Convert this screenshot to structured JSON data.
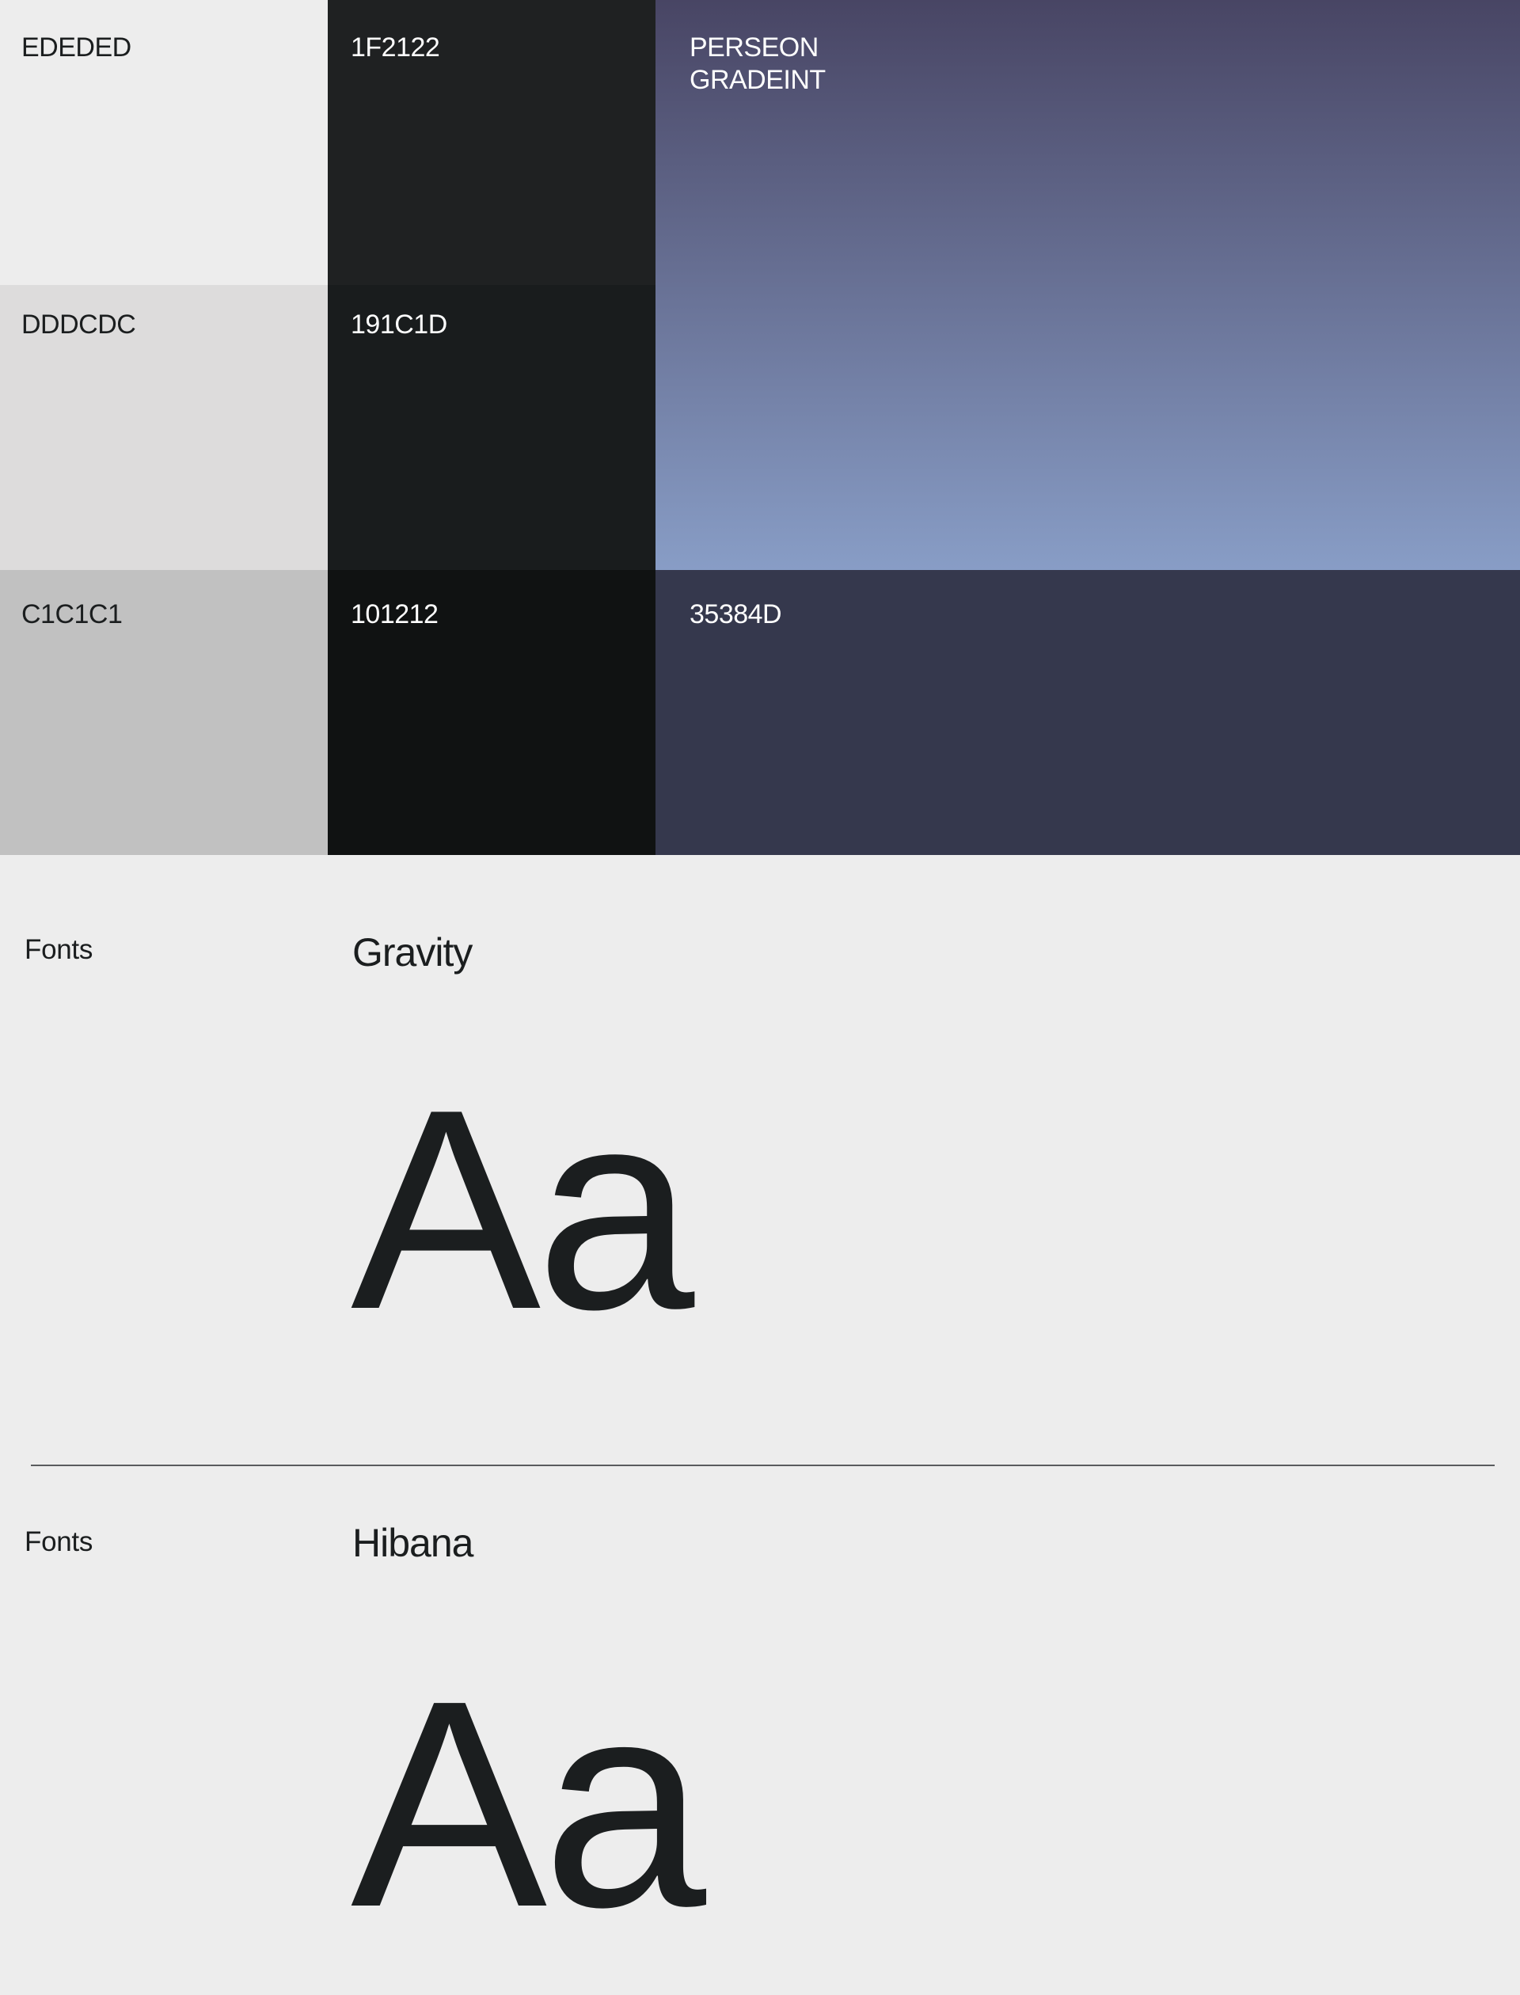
{
  "palette": {
    "light": [
      {
        "label": "EDEDED",
        "color": "#EDEDED"
      },
      {
        "label": "DDDCDC",
        "color": "#DDDCDC"
      },
      {
        "label": "C1C1C1",
        "color": "#C1C1C1"
      }
    ],
    "dark": [
      {
        "label": "1F2122",
        "color": "#1F2122"
      },
      {
        "label": "191C1D",
        "color": "#191C1D"
      },
      {
        "label": "101212",
        "color": "#101212"
      }
    ],
    "gradient": {
      "label": "PERSEON\nGRADEINT",
      "color_top": "#484564",
      "color_bottom": "#889DC6"
    },
    "accent": {
      "label": "35384D",
      "color": "#35384D"
    }
  },
  "fonts": [
    {
      "section_label": "Fonts",
      "name": "Gravity",
      "sample": "Aa"
    },
    {
      "section_label": "Fonts",
      "name": "Hibana",
      "sample": "Aa"
    }
  ]
}
